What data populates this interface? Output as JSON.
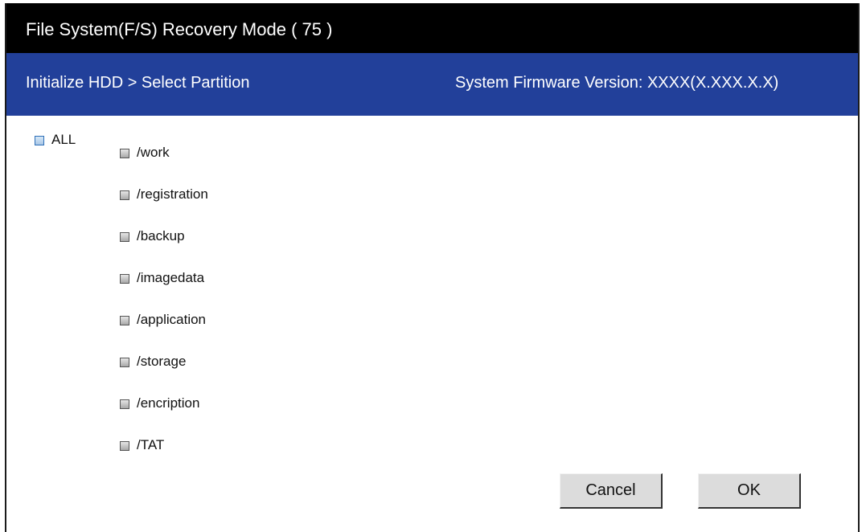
{
  "title_bar": {
    "title": "File System(F/S) Recovery Mode ( 75 )"
  },
  "header": {
    "breadcrumb": "Initialize HDD > Select Partition",
    "firmware_label": "System Firmware Version: XXXX(X.XXX.X.X)"
  },
  "all_checkbox": {
    "label": "ALL",
    "checked": false
  },
  "partitions": [
    {
      "label": "/work",
      "checked": false
    },
    {
      "label": "/registration",
      "checked": false
    },
    {
      "label": "/backup",
      "checked": false
    },
    {
      "label": "/imagedata",
      "checked": false
    },
    {
      "label": "/application",
      "checked": false
    },
    {
      "label": "/storage",
      "checked": false
    },
    {
      "label": "/encription",
      "checked": false
    },
    {
      "label": "/TAT",
      "checked": false
    }
  ],
  "buttons": {
    "cancel_label": "Cancel",
    "ok_label": "OK"
  },
  "colors": {
    "title_bar_bg": "#000000",
    "header_bg": "#22409a",
    "button_bg": "#dcdcdc"
  }
}
